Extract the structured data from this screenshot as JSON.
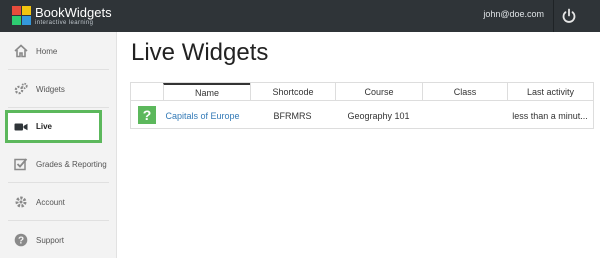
{
  "header": {
    "brand_name": "BookWidgets",
    "brand_tagline": "interactive learning",
    "user_email": "john@doe.com",
    "logo_colors": [
      "#e74c3c",
      "#f1c40f",
      "#2ecc71",
      "#3498db"
    ],
    "power_icon": "power-icon"
  },
  "sidebar": {
    "items": [
      {
        "label": "Home",
        "icon": "home-icon"
      },
      {
        "label": "Widgets",
        "icon": "gears-icon"
      },
      {
        "label": "Live",
        "icon": "video-camera-icon",
        "active": true
      },
      {
        "label": "Grades & Reporting",
        "icon": "checkbox-icon"
      },
      {
        "label": "Account",
        "icon": "gear-icon"
      },
      {
        "label": "Support",
        "icon": "question-icon"
      }
    ],
    "active_color": "#5cb85c"
  },
  "main": {
    "title": "Live Widgets",
    "columns": [
      "Name",
      "Shortcode",
      "Course",
      "Class",
      "Last activity"
    ],
    "rows": [
      {
        "icon": "question-mark-icon",
        "icon_glyph": "?",
        "name": "Capitals of Europe",
        "shortcode": "BFRMRS",
        "course": "Geography 101",
        "class": "",
        "last_activity": "less than a minut..."
      }
    ]
  }
}
